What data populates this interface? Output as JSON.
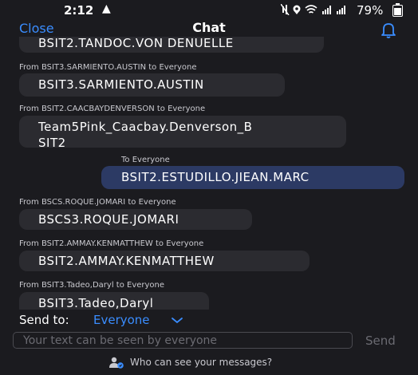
{
  "status_bar": {
    "time": "2:12",
    "battery": "79%",
    "icons": [
      "mute-icon",
      "location-icon",
      "wifi-icon",
      "signal-icon",
      "signal-icon"
    ]
  },
  "header": {
    "close_label": "Close",
    "title": "Chat",
    "bell_icon": "bell-icon"
  },
  "messages": [
    {
      "label": "",
      "text": "BSIT2.TANDOC.VON DENUELLE"
    },
    {
      "label": "From BSIT3.SARMIENTO.AUSTIN to Everyone",
      "text": "BSIT3.SARMIENTO.AUSTIN"
    },
    {
      "label": "From BSIT2.CAACBAYDENVERSON to Everyone",
      "lines": [
        "Team5Pink_Caacbay.Denverson_B",
        "SIT2"
      ]
    },
    {
      "label": "To Everyone",
      "text": "BSIT2.ESTUDILLO.JIEAN.MARC"
    },
    {
      "label": "From BSCS.ROQUE.JOMARI to Everyone",
      "text": "BSCS3.ROQUE.JOMARI"
    },
    {
      "label": "From BSIT2.AMMAY.KENMATTHEW to Everyone",
      "text": "BSIT2.AMMAY.KENMATTHEW"
    },
    {
      "label": "From BSIT3.Tadeo,Daryl to Everyone",
      "text": "BSIT3.Tadeo,Daryl"
    }
  ],
  "composer": {
    "send_to_label": "Send to:",
    "send_to_value": "Everyone",
    "input_placeholder": "Your text can be seen by everyone",
    "send_label": "Send",
    "privacy_text": "Who can see your messages?"
  },
  "colors": {
    "background": "#1b1b1f",
    "accent": "#3a8dff",
    "bubble": "#2b2b30",
    "self_bubble": "#2c3a64"
  }
}
